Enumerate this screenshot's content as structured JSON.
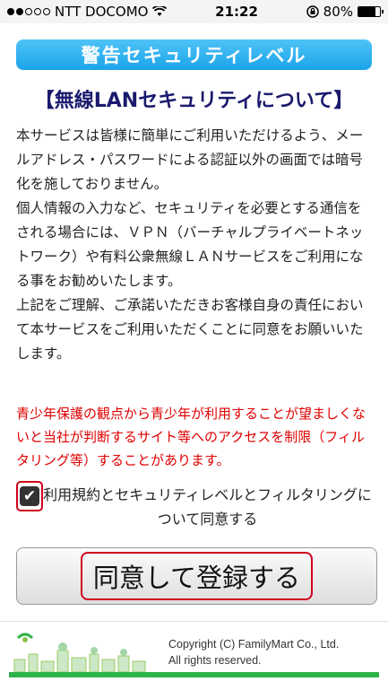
{
  "status_bar": {
    "carrier": "NTT DOCOMO",
    "time": "21:22",
    "battery_percent_text": "80%",
    "battery_level": 0.8,
    "signal_dots_filled": 2,
    "signal_dots_total": 5,
    "icons": [
      "wifi-icon",
      "rotation-lock-icon",
      "battery-icon"
    ]
  },
  "banner": {
    "title": "警告セキュリティレベル"
  },
  "notice": {
    "heading": "【無線LANセキュリティについて】",
    "paragraphs": [
      "本サービスは皆様に簡単にご利用いただけるよう、メールアドレス・パスワードによる認証以外の画面では暗号化を施しておりません。",
      "個人情報の入力など、セキュリティを必要とする通信をされる場合には、ＶＰＮ（バーチャルプライベートネットワーク）や有料公衆無線ＬＡＮサービスをご利用になる事をお勧めいたします。",
      "上記をご理解、ご承諾いただきお客様自身の責任において本サービスをご利用いただくことに同意をお願いいたします。"
    ],
    "warning": "青少年保護の観点から青少年が利用することが望ましくないと当社が判断するサイト等へのアクセスを制限（フィルタリング等）することがあります。"
  },
  "agreement": {
    "checked": true,
    "label": "利用規約とセキュリティレベルとフィルタリングについて同意する"
  },
  "submit": {
    "label": "同意して登録する"
  },
  "footer": {
    "copyright_line1": "Copyright (C) FamilyMart Co., Ltd.",
    "copyright_line2": "All rights reserved."
  },
  "colors": {
    "banner": "#1ba4e9",
    "heading": "#1a1a6e",
    "warning": "#e00000",
    "highlight_border": "#d0021b",
    "footer_bar": "#2db34a"
  }
}
